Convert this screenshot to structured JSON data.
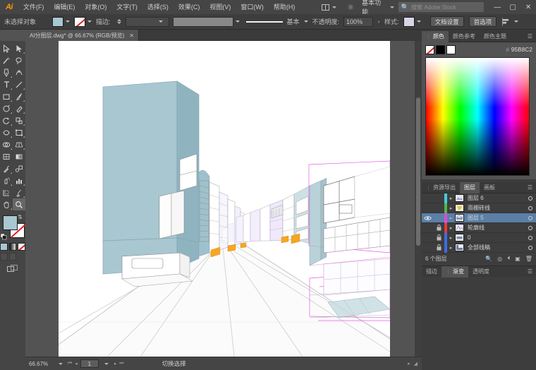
{
  "app": {
    "name": "Adobe Illustrator",
    "logo_text": "Ai"
  },
  "menubar": {
    "items": [
      {
        "label": "文件(F)",
        "name": "menu-file"
      },
      {
        "label": "编辑(E)",
        "name": "menu-edit"
      },
      {
        "label": "对象(O)",
        "name": "menu-object"
      },
      {
        "label": "文字(T)",
        "name": "menu-type"
      },
      {
        "label": "选择(S)",
        "name": "menu-select"
      },
      {
        "label": "效果(C)",
        "name": "menu-effect"
      },
      {
        "label": "视图(V)",
        "name": "menu-view"
      },
      {
        "label": "窗口(W)",
        "name": "menu-window"
      },
      {
        "label": "帮助(H)",
        "name": "menu-help"
      }
    ],
    "workspace": "基本功能",
    "stock_placeholder": "搜索 Adobe Stock",
    "window_controls": {
      "minimize": "—",
      "maximize": "▢",
      "close": "✕"
    }
  },
  "controlbar": {
    "selection_status": "未选择对象",
    "fill_color": "#a8c7d1",
    "stroke_label": "描边:",
    "stroke_weight": "",
    "stroke_profile": "",
    "stroke_style": "基本",
    "opacity_label": "不透明度:",
    "opacity_value": "100%",
    "style_label": "样式:",
    "doc_setup_button": "文档设置",
    "preferences_button": "首选项"
  },
  "document": {
    "tab_title": "AI分图层.dwg* @ 66.67% (RGB/预览)",
    "close_glyph": "✕"
  },
  "toolbar": {
    "tools": [
      {
        "name": "selection-tool",
        "label": "选择工具"
      },
      {
        "name": "direct-selection-tool",
        "label": "直接选择工具"
      },
      {
        "name": "magic-wand-tool",
        "label": "魔棒工具"
      },
      {
        "name": "lasso-tool",
        "label": "套索工具"
      },
      {
        "name": "pen-tool",
        "label": "钢笔工具"
      },
      {
        "name": "curvature-tool",
        "label": "曲率工具"
      },
      {
        "name": "type-tool",
        "label": "文字工具"
      },
      {
        "name": "line-segment-tool",
        "label": "直线段工具"
      },
      {
        "name": "rectangle-tool",
        "label": "矩形工具"
      },
      {
        "name": "paintbrush-tool",
        "label": "画笔工具"
      },
      {
        "name": "shaper-tool",
        "label": "Shaper 工具"
      },
      {
        "name": "eraser-tool",
        "label": "橡皮擦工具"
      },
      {
        "name": "rotate-tool",
        "label": "旋转工具"
      },
      {
        "name": "scale-tool",
        "label": "缩放工具"
      },
      {
        "name": "width-tool",
        "label": "宽度工具"
      },
      {
        "name": "free-transform-tool",
        "label": "自由变换工具"
      },
      {
        "name": "shape-builder-tool",
        "label": "形状生成器工具"
      },
      {
        "name": "perspective-grid-tool",
        "label": "透视网格工具"
      },
      {
        "name": "mesh-tool",
        "label": "网格工具"
      },
      {
        "name": "gradient-tool",
        "label": "渐变工具"
      },
      {
        "name": "eyedropper-tool",
        "label": "吸管工具"
      },
      {
        "name": "blend-tool",
        "label": "混合工具"
      },
      {
        "name": "symbol-sprayer-tool",
        "label": "符号喷枪工具"
      },
      {
        "name": "column-graph-tool",
        "label": "柱形图工具"
      },
      {
        "name": "artboard-tool",
        "label": "画板工具"
      },
      {
        "name": "slice-tool",
        "label": "切片工具"
      },
      {
        "name": "hand-tool",
        "label": "抓手工具"
      },
      {
        "name": "zoom-tool",
        "label": "缩放显示工具"
      }
    ],
    "active_tool": "zoom-tool",
    "fill_color": "#a8c7d1",
    "stroke_color": "none",
    "color_modes": [
      "颜色",
      "渐变",
      "无"
    ],
    "draw_modes": [
      "正常绘图",
      "背面绘图",
      "内部绘图"
    ],
    "screen_mode": "更改屏幕模式"
  },
  "statusbar": {
    "zoom": "66.67%",
    "page": "1",
    "status_text": "切换选择"
  },
  "panels": {
    "color_group": {
      "tabs": [
        {
          "label": "颜色",
          "active": true,
          "name": "tab-color"
        },
        {
          "label": "颜色参考",
          "active": false,
          "name": "tab-color-guide"
        },
        {
          "label": "颜色主题",
          "active": false,
          "name": "tab-color-themes"
        }
      ],
      "hex_prefix": "#",
      "hex_value": "95B8C2",
      "swatches": [
        "none",
        "#000000",
        "#ffffff"
      ]
    },
    "layers_group": {
      "tabs": [
        {
          "label": "资源导出",
          "active": false,
          "name": "tab-asset-export"
        },
        {
          "label": "图层",
          "active": true,
          "name": "tab-layers"
        },
        {
          "label": "画板",
          "active": false,
          "name": "tab-artboards"
        }
      ],
      "layers": [
        {
          "name": "图层 6",
          "color": "#4cc8d8",
          "visible": false,
          "locked": false,
          "selected": false
        },
        {
          "name": "雨棚砖线",
          "color": "#49b84c",
          "visible": false,
          "locked": false,
          "selected": false
        },
        {
          "name": "图层 5",
          "color": "#d84cd8",
          "visible": true,
          "locked": false,
          "selected": true
        },
        {
          "name": "轮廓线",
          "color": "#e03c3c",
          "visible": false,
          "locked": true,
          "selected": false
        },
        {
          "name": "0",
          "color": "#3c6ce0",
          "visible": false,
          "locked": true,
          "selected": false
        },
        {
          "name": "全部线稿",
          "color": "#3c6ce0",
          "visible": false,
          "locked": true,
          "selected": false
        }
      ],
      "count_label": "6 个图层",
      "footer_icons": [
        "locate-object-icon",
        "make-mask-icon",
        "new-sublayer-icon",
        "new-layer-icon",
        "delete-layer-icon"
      ]
    },
    "bottom_tabs": [
      {
        "label": "描边",
        "active": false,
        "name": "tab-stroke"
      },
      {
        "label": "渐变",
        "active": true,
        "name": "tab-gradient"
      },
      {
        "label": "透明度",
        "active": false,
        "name": "tab-transparency"
      }
    ]
  },
  "artwork": {
    "description": "一点透视街景线稿，左侧大体块建筑填充青灰色，右侧建筑为线框，中央为道路消失点",
    "colors": {
      "building_face": "#a8c7d1",
      "building_side": "#8fb4c0",
      "outline_magenta": "#e060e0",
      "outline_violet": "#9a8fd8",
      "awning_orange": "#f5a623",
      "road_line": "#b8b8b8"
    }
  }
}
